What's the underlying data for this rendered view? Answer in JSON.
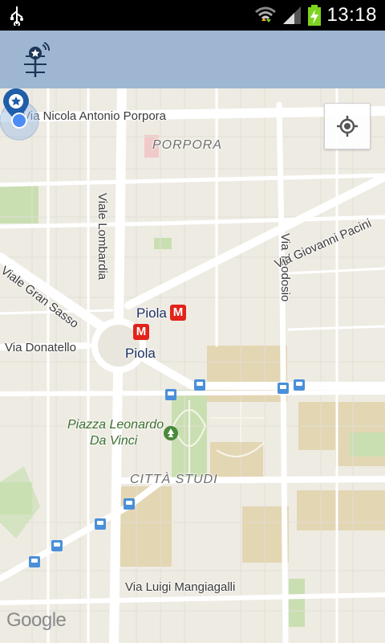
{
  "status_bar": {
    "time": "13:18",
    "icons": [
      "usb-icon",
      "wifi-icon",
      "signal-icon",
      "battery-charging-icon"
    ]
  },
  "app_bar": {
    "logo_icon": "antenna-star-pin-icon"
  },
  "map": {
    "labels": {
      "via_nicola_antonio_porpora": "Via Nicola Antonio Porpora",
      "porpora": "PORPORA",
      "via_teodosio": "Via Teodosio",
      "viale_lombardia": "Viale Lombardia",
      "via_giovanni_pacini": "Via Giovanni Pacini",
      "viale_gran_sasso": "Viale Gran Sasso",
      "piola_1": "Piola",
      "piola_2": "Piola",
      "via_donatello": "Via Donatello",
      "piazza_leonardo_line1": "Piazza Leonardo",
      "piazza_leonardo_line2": "Da Vinci",
      "citta_studi": "CITTÀ STUDI",
      "via_luigi_mangiagalli": "Via Luigi Mangiagalli"
    },
    "metro_symbol": "M",
    "attribution": "Google",
    "my_location_button_icon": "crosshair-icon"
  },
  "colors": {
    "app_bar": "#9fb6d3",
    "map_bg": "#eeebe3",
    "road": "#ffffff",
    "campus": "#e3d6b3",
    "park": "#c9dfb2",
    "metro": "#e2231a",
    "pin": "#1f5ea8",
    "location_dot": "#4c8df5"
  }
}
